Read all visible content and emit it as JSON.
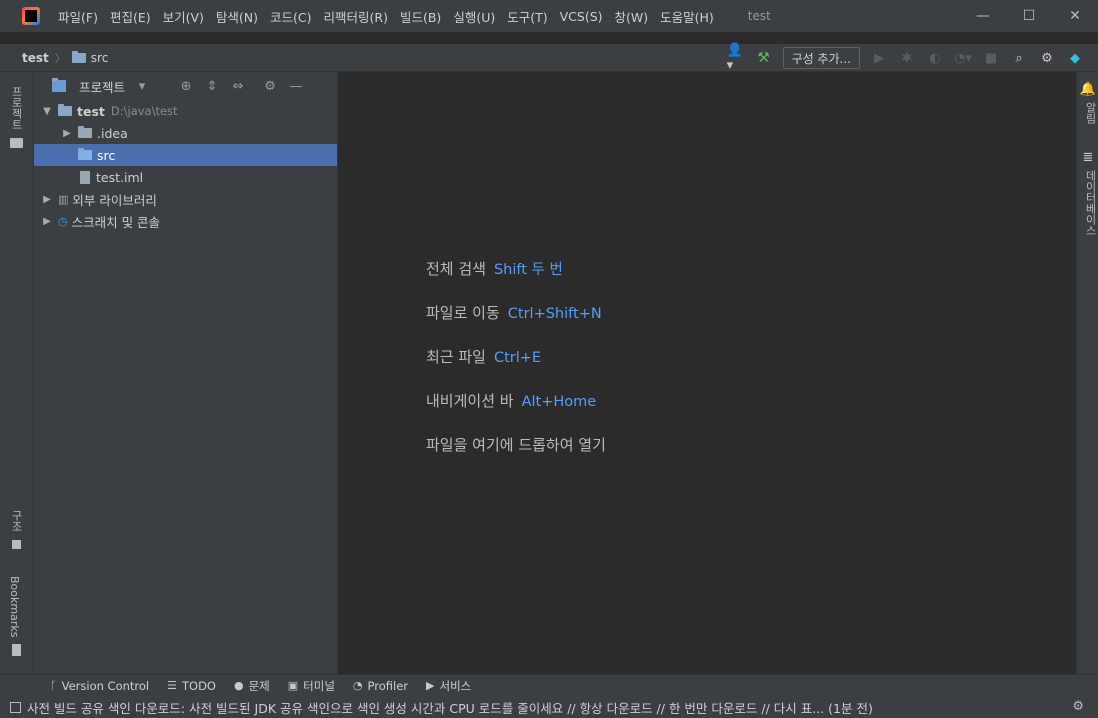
{
  "menu": {
    "items": [
      "파일(F)",
      "편집(E)",
      "보기(V)",
      "탐색(N)",
      "코드(C)",
      "리팩터링(R)",
      "빌드(B)",
      "실행(U)",
      "도구(T)",
      "VCS(S)",
      "창(W)",
      "도움말(H)"
    ],
    "window_title": "test"
  },
  "navbar": {
    "crumbs": [
      "test",
      "src"
    ],
    "add_config_label": "구성 추가..."
  },
  "left_strip": {
    "project_tab": "프로젝트",
    "structure_tab": "구조",
    "bookmarks_tab": "Bookmarks"
  },
  "right_strip": {
    "notifications_tab": "알림",
    "database_tab": "데이터베이스"
  },
  "project_panel": {
    "title": "프로젝트",
    "tree": [
      {
        "label": "test",
        "hint": "D:\\java\\test"
      },
      {
        "label": ".idea"
      },
      {
        "label": "src"
      },
      {
        "label": "test.iml"
      },
      {
        "label": "외부 라이브러리"
      },
      {
        "label": "스크래치 및 콘솔"
      }
    ]
  },
  "editor_hints": [
    {
      "label": "전체 검색",
      "key": "Shift 두 번"
    },
    {
      "label": "파일로 이동",
      "key": "Ctrl+Shift+N"
    },
    {
      "label": "최근 파일",
      "key": "Ctrl+E"
    },
    {
      "label": "내비게이션 바",
      "key": "Alt+Home"
    },
    {
      "label": "파일을 여기에 드롭하여 열기",
      "key": ""
    }
  ],
  "bottom_tabs": [
    "Version Control",
    "TODO",
    "문제",
    "터미널",
    "Profiler",
    "서비스"
  ],
  "status": {
    "message": "사전 빌드 공유 색인 다운로드: 사전 빌드된 JDK 공유 색인으로 색인 생성 시간과 CPU 로드를 줄이세요 // 항상 다운로드 // 한 번만 다운로드 // 다시 표... (1분 전)"
  },
  "colors": {
    "selection": "#4b6eaf",
    "shortcut": "#589df6",
    "panel": "#3c3f41",
    "editor": "#2b2b2b"
  }
}
